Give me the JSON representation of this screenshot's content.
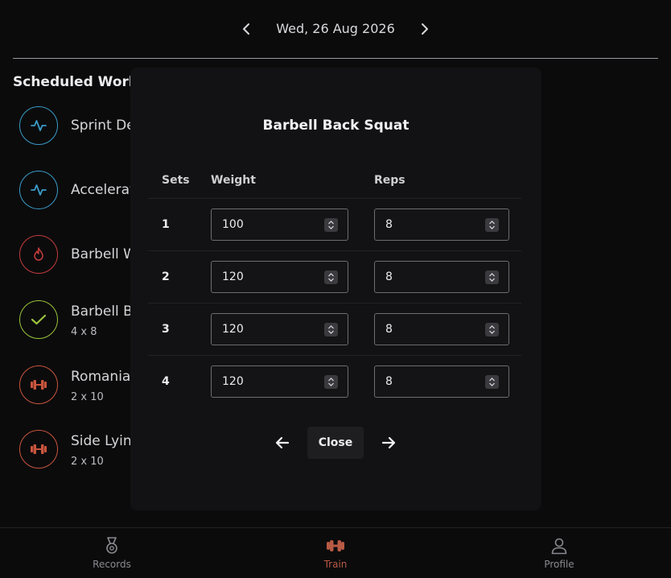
{
  "header": {
    "date": "Wed, 26 Aug 2026"
  },
  "section_title": "Scheduled Work",
  "workouts": [
    {
      "name": "Sprint De",
      "sub": "",
      "icon": "activity-icon",
      "color": "#3a9bc6"
    },
    {
      "name": "Accelerat",
      "sub": "",
      "icon": "activity-icon",
      "color": "#3a9bc6"
    },
    {
      "name": "Barbell W",
      "sub": "",
      "icon": "flame-icon",
      "color": "#c43c3c"
    },
    {
      "name": "Barbell B",
      "sub": "4 x 8",
      "icon": "check-icon",
      "color": "#9bc43a"
    },
    {
      "name": "Romania",
      "sub": "2 x 10",
      "icon": "dumbbell-icon",
      "color": "#c8553d"
    },
    {
      "name": "Side Lyin",
      "sub": "2 x 10",
      "icon": "dumbbell-icon",
      "color": "#c8553d"
    }
  ],
  "modal": {
    "title": "Barbell Back Squat",
    "headers": {
      "sets": "Sets",
      "weight": "Weight",
      "reps": "Reps"
    },
    "rows": [
      {
        "set": "1",
        "weight": "100",
        "reps": "8"
      },
      {
        "set": "2",
        "weight": "120",
        "reps": "8"
      },
      {
        "set": "3",
        "weight": "120",
        "reps": "8"
      },
      {
        "set": "4",
        "weight": "120",
        "reps": "8"
      }
    ],
    "close_label": "Close"
  },
  "bottom_nav": [
    {
      "label": "Records",
      "icon": "medal-icon",
      "active": false
    },
    {
      "label": "Train",
      "icon": "dumbbell-icon",
      "active": true
    },
    {
      "label": "Profile",
      "icon": "person-icon",
      "active": false
    }
  ],
  "colors": {
    "accent": "#b85a44",
    "blue": "#3a9bc6",
    "red": "#c43c3c",
    "green": "#9bc43a",
    "orange": "#c8553d"
  }
}
